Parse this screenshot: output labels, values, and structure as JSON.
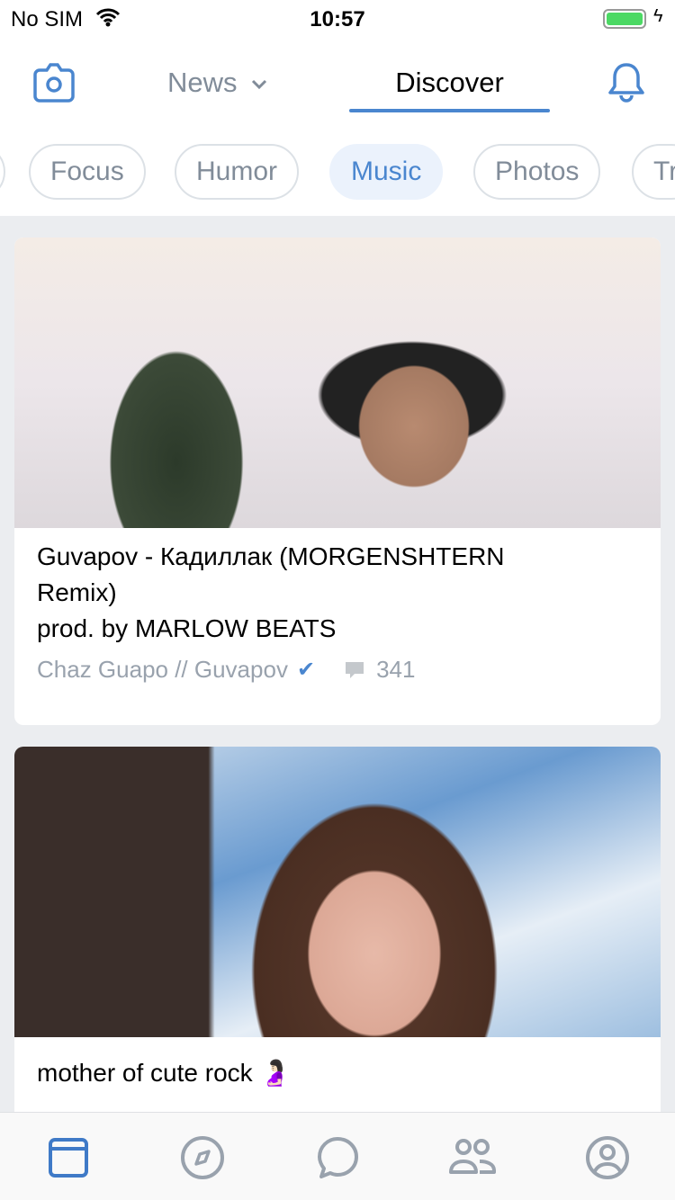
{
  "status_bar": {
    "carrier": "No SIM",
    "time": "10:57"
  },
  "header": {
    "news_label": "News",
    "discover_label": "Discover"
  },
  "chips": [
    {
      "label": ""
    },
    {
      "label": "Focus"
    },
    {
      "label": "Humor"
    },
    {
      "label": "Music",
      "active": true
    },
    {
      "label": "Photos"
    },
    {
      "label": "Tr"
    }
  ],
  "posts": [
    {
      "title_lines": [
        "Guvapov - Кадиллак (MORGENSHTERN",
        "Remix)",
        "prod. by MARLOW BEATS"
      ],
      "author": "Chaz Guapo // Guvapov",
      "verified": true,
      "comments": "341"
    },
    {
      "title": "mother of cute rock 🤰🏻"
    }
  ],
  "colors": {
    "accent": "#4a86cf",
    "secondary": "#818c99",
    "background": "#ebedf0"
  },
  "tabbar": [
    "feed-icon",
    "discover-icon",
    "messages-icon",
    "friends-icon",
    "profile-icon"
  ]
}
